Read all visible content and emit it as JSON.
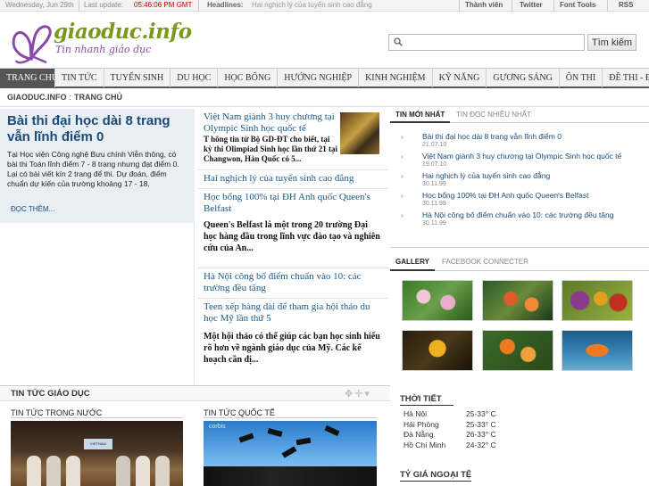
{
  "topbar": {
    "date": "Wednesday, Jun 29th",
    "last_update_label": "Last update:",
    "last_update_time": "05:46:06 PM GMT",
    "headlines_label": "Headlines:",
    "headline": "Hai nghịch lý của tuyển sinh cao đẳng",
    "links": [
      "Thành viên",
      "Twitter",
      "Font Tools",
      "RSS"
    ]
  },
  "header": {
    "logo_title": "giaoduc.info",
    "logo_tagline": "Tin nhanh giáo dục",
    "search_placeholder": "",
    "search_button": "Tìm kiếm"
  },
  "nav": {
    "items": [
      "TRANG CHỦ",
      "TIN TỨC",
      "TUYỂN SINH",
      "DU HỌC",
      "HỌC BỔNG",
      "HƯỚNG NGHIỆP",
      "KINH NGHIỆM",
      "KỸ NĂNG",
      "GƯƠNG SÁNG",
      "ÔN THI",
      "ĐỀ THI - ĐÁP ÁN"
    ]
  },
  "breadcrumb": {
    "site": "GIAODUC.INFO",
    "sep": ":",
    "page": "TRANG CHỦ"
  },
  "featured": {
    "title": "Bài thi đại học dài 8 trang vẫn lĩnh điểm 0",
    "summary": "Tại Học viện Công nghệ Bưu chính Viễn thông, có bài thi Toán lĩnh điểm 7 - 8 trang nhưng đạt điểm 0. Lại có bài viết kín 2 trang để thi. Dự đoán, điểm chuẩn dự kiến của trường khoảng 17 - 18.",
    "more": "ĐỌC THÊM..."
  },
  "middle": {
    "story1_title": "Việt Nam giành 3 huy chương tại Olympic Sinh học quốc tế",
    "story1_text": "T hông tin từ Bộ GD-ĐT cho biết, tại kỳ thi Olimpiad Sinh học lần thứ 21 tại Changwon, Hàn Quốc có 5...",
    "story2_title": "Hai nghịch lý của tuyển sinh cao đẳng",
    "story3_title": "Học bổng 100% tại ĐH Anh quốc Queen's Belfast",
    "story3_text": "Queen's Belfast là một trong 20 trường Đại học hàng đầu trong lĩnh vực đào tạo và nghiên cứu của An...",
    "story4_title": "Hà Nội công bố điểm chuẩn vào 10: các trường đều tăng",
    "story5_title": "Teen xếp hàng dài để tham gia hội thảo du học Mỹ lần thứ 5",
    "story5_text": "Một hội thảo có thể giúp các bạn học sinh hiểu rõ hơn về ngành giáo dục của Mỹ. Các kế hoạch cần đị..."
  },
  "right": {
    "tabs": [
      "TIN MỚI NHẤT",
      "TIN ĐỌC NHIỀU NHẤT"
    ],
    "news": [
      {
        "title": "Bài thi đại học dài 8 trang vẫn lĩnh điểm 0",
        "date": ""
      },
      {
        "title": "Việt Nam giành 3 huy chương tại Olympic Sinh học quốc tế",
        "date": "19.07.10"
      },
      {
        "title": "Hai nghịch lý của tuyển sinh cao đẳng",
        "date": "30.11.99"
      },
      {
        "title": "Học bổng 100% tại ĐH Anh quốc Queen's Belfast",
        "date": "30.11.99"
      },
      {
        "title": "Hà Nội công bố điểm chuẩn vào 10: các trường đều tăng",
        "date": "30.11.99"
      }
    ],
    "news0_date": "21.07.10",
    "gallery_tabs": [
      "GALLERY",
      "FACEBOOK CONNECTER"
    ]
  },
  "bottom": {
    "section_title": "TIN TỨC GIÁO DỤC",
    "col1_title": "TIN TỨC TRONG NƯỚC",
    "col2_title": "TIN TỨC QUỐC TẾ",
    "photo2_watermark": "corbis",
    "photo1_banner": "VIETNAM"
  },
  "weather": {
    "title": "THỜI TIẾT",
    "rows": [
      {
        "city": "Hà Nội",
        "temp": "25-33° C"
      },
      {
        "city": "Hải Phòng",
        "temp": "25-33° C"
      },
      {
        "city": "Đà Nẵng",
        "temp": "26-33° C"
      },
      {
        "city": "Hồ Chí Minh",
        "temp": "24-32° C"
      }
    ]
  },
  "exchange": {
    "title": "TỶ GIÁ NGOẠI TỆ"
  },
  "colors": {
    "accent_red": "#cc0000",
    "link_blue": "#1a4a7a",
    "nav_active": "#555555",
    "logo_green": "#7a9a1e",
    "logo_purple": "#8a4aa8"
  }
}
